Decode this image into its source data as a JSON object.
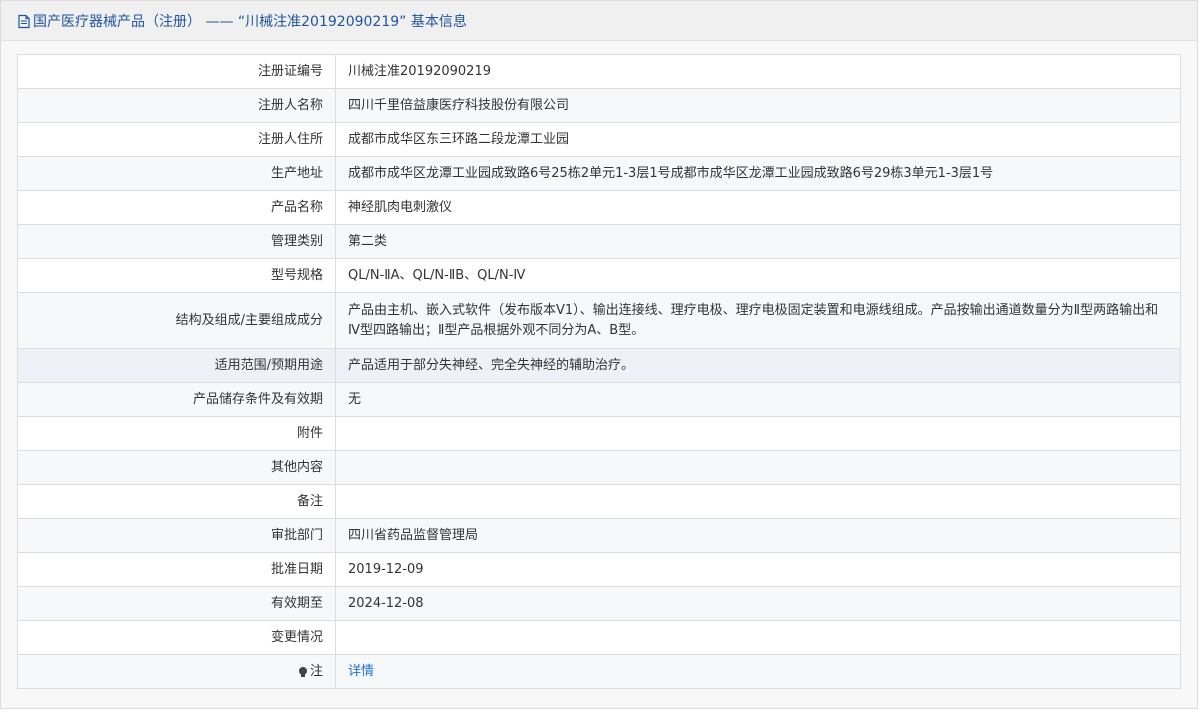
{
  "header": {
    "icon": "document-icon",
    "title": "国产医疗器械产品（注册）  ——  “川械注准20192090219” 基本信息"
  },
  "rows": [
    {
      "label": "注册证编号",
      "value": "川械注准20192090219"
    },
    {
      "label": "注册人名称",
      "value": "四川千里倍益康医疗科技股份有限公司"
    },
    {
      "label": "注册人住所",
      "value": "成都市成华区东三环路二段龙潭工业园"
    },
    {
      "label": "生产地址",
      "value": "成都市成华区龙潭工业园成致路6号25栋2单元1-3层1号成都市成华区龙潭工业园成致路6号29栋3单元1-3层1号"
    },
    {
      "label": "产品名称",
      "value": "神经肌肉电刺激仪"
    },
    {
      "label": "管理类别",
      "value": "第二类"
    },
    {
      "label": "型号规格",
      "value": "QL/N-ⅡA、QL/N-ⅡB、QL/N-Ⅳ"
    },
    {
      "label": "结构及组成/主要组成成分",
      "value": "产品由主机、嵌入式软件（发布版本V1）、输出连接线、理疗电极、理疗电极固定装置和电源线组成。产品按输出通道数量分为Ⅱ型两路输出和Ⅳ型四路输出；Ⅱ型产品根据外观不同分为A、B型。"
    },
    {
      "label": "适用范围/预期用途",
      "value": "产品适用于部分失神经、完全失神经的辅助治疗。"
    },
    {
      "label": "产品储存条件及有效期",
      "value": "无"
    },
    {
      "label": "附件",
      "value": ""
    },
    {
      "label": "其他内容",
      "value": ""
    },
    {
      "label": "备注",
      "value": ""
    },
    {
      "label": "审批部门",
      "value": "四川省药品监督管理局"
    },
    {
      "label": "批准日期",
      "value": "2019-12-09"
    },
    {
      "label": "有效期至",
      "value": "2024-12-08"
    },
    {
      "label": "变更情况",
      "value": ""
    },
    {
      "label": "注",
      "value": "详情",
      "icon": "lightbulb-icon"
    }
  ],
  "colors": {
    "header_text": "#1f55a0",
    "link": "#1f6fd0",
    "border": "#dddddd"
  }
}
